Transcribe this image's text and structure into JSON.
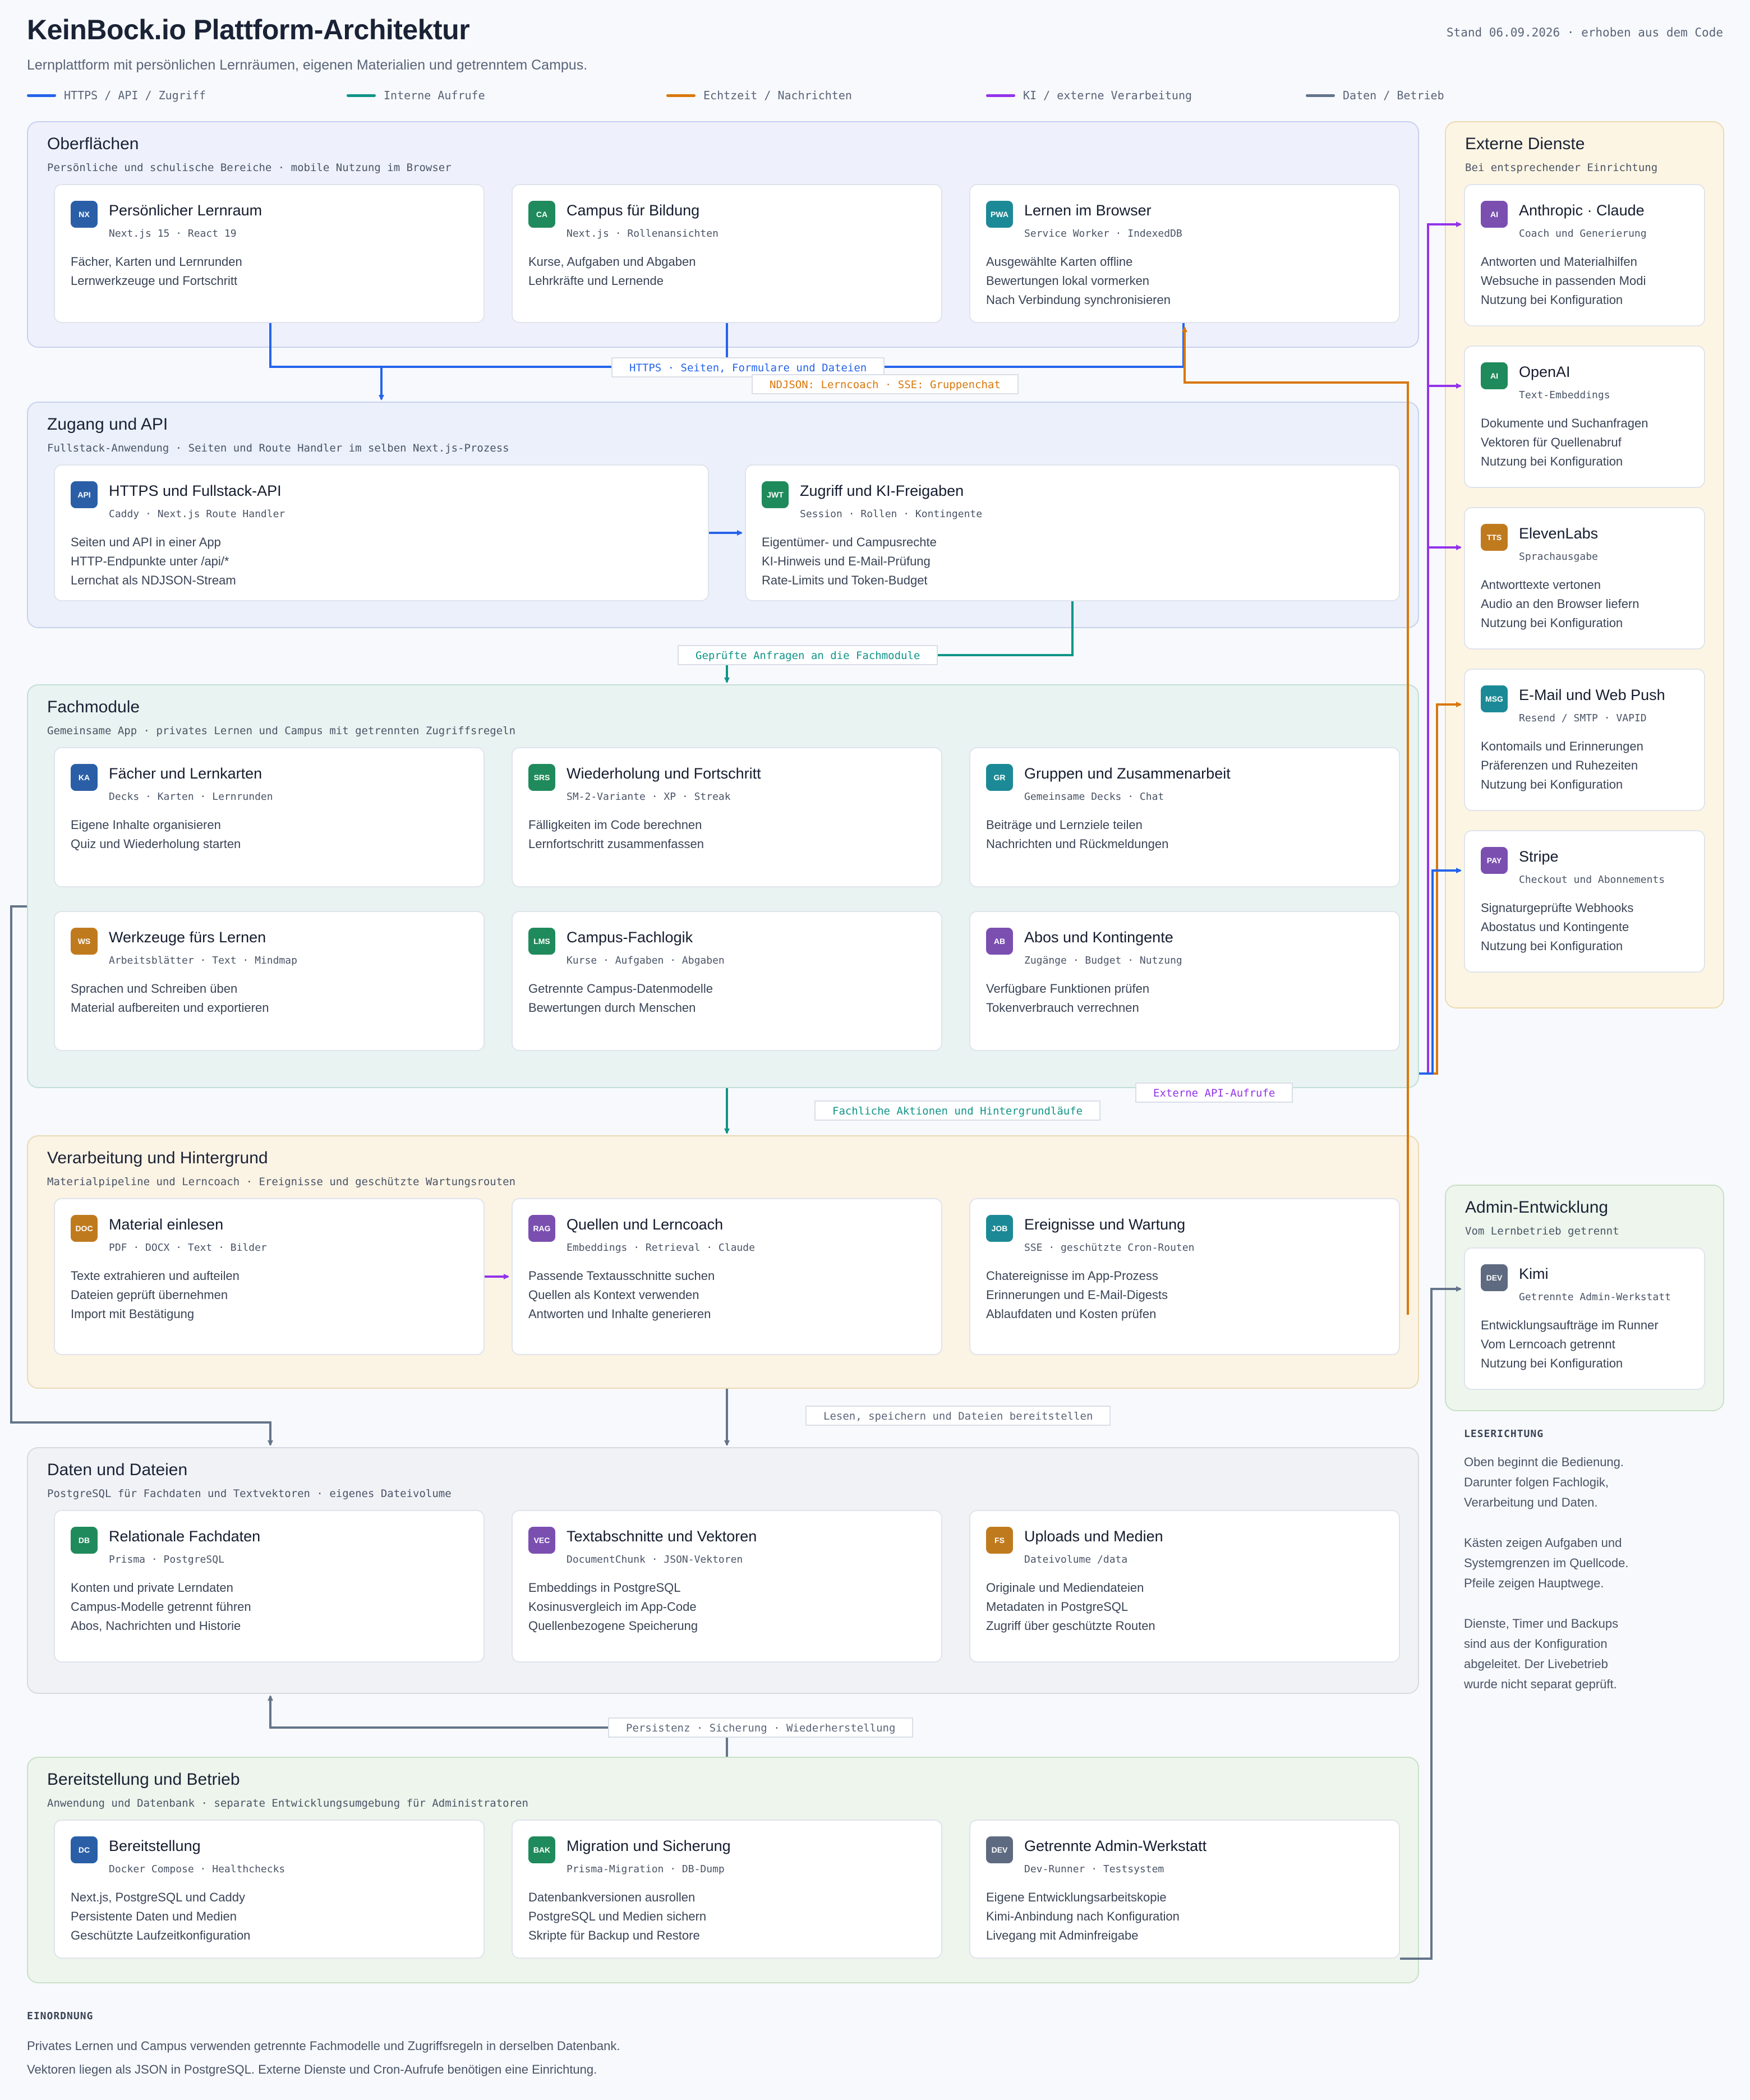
{
  "header": {
    "title": "KeinBock.io Plattform-Architektur",
    "subtitle": "Lernplattform mit persönlichen Lernräumen, eigenen Materialien und getrenntem Campus.",
    "stand": "Stand 06.09.2026 · erhoben aus dem Code"
  },
  "legend": [
    {
      "label": "HTTPS / API / Zugriff",
      "color": "#2563eb"
    },
    {
      "label": "Interne Aufrufe",
      "color": "#0f9488"
    },
    {
      "label": "Echtzeit / Nachrichten",
      "color": "#d9770b"
    },
    {
      "label": "KI / externe Verarbeitung",
      "color": "#9333ea"
    },
    {
      "label": "Daten / Betrieb",
      "color": "#64748b"
    }
  ],
  "zones": {
    "surfaces": {
      "title": "Oberflächen",
      "sub": "Persönliche und schulische Bereiche · mobile Nutzung im Browser"
    },
    "access": {
      "title": "Zugang und API",
      "sub": "Fullstack-Anwendung · Seiten und Route Handler im selben Next.js-Prozess"
    },
    "domain": {
      "title": "Fachmodule",
      "sub": "Gemeinsame App · privates Lernen und Campus mit getrennten Zugriffsregeln"
    },
    "processing": {
      "title": "Verarbeitung und Hintergrund",
      "sub": "Materialpipeline und Lerncoach · Ereignisse und geschützte Wartungsrouten"
    },
    "data": {
      "title": "Daten und Dateien",
      "sub": "PostgreSQL für Fachdaten und Textvektoren · eigenes Dateivolume"
    },
    "ops": {
      "title": "Bereitstellung und Betrieb",
      "sub": "Anwendung und Datenbank · separate Entwicklungsumgebung für Administratoren"
    },
    "external": {
      "title": "Externe Dienste",
      "sub": "Bei entsprechender Einrichtung"
    },
    "admin": {
      "title": "Admin-Entwicklung",
      "sub": "Vom Lernbetrieb getrennt"
    }
  },
  "cards": {
    "nx": {
      "badge": "NX",
      "title": "Persönlicher Lernraum",
      "sub": "Next.js 15 · React 19",
      "lines": [
        "Fächer, Karten und Lernrunden",
        "Lernwerkzeuge und Fortschritt"
      ]
    },
    "ca": {
      "badge": "CA",
      "title": "Campus für Bildung",
      "sub": "Next.js · Rollenansichten",
      "lines": [
        "Kurse, Aufgaben und Abgaben",
        "Lehrkräfte und Lernende"
      ]
    },
    "pwa": {
      "badge": "PWA",
      "title": "Lernen im Browser",
      "sub": "Service Worker · IndexedDB",
      "lines": [
        "Ausgewählte Karten offline",
        "Bewertungen lokal vormerken",
        "Nach Verbindung synchronisieren"
      ]
    },
    "api": {
      "badge": "API",
      "title": "HTTPS und Fullstack-API",
      "sub": "Caddy · Next.js Route Handler",
      "lines": [
        "Seiten und API in einer App",
        "HTTP-Endpunkte unter /api/*",
        "Lernchat als NDJSON-Stream"
      ]
    },
    "jwt": {
      "badge": "JWT",
      "title": "Zugriff und KI-Freigaben",
      "sub": "Session · Rollen · Kontingente",
      "lines": [
        "Eigentümer- und Campusrechte",
        "KI-Hinweis und E-Mail-Prüfung",
        "Rate-Limits und Token-Budget"
      ]
    },
    "ka": {
      "badge": "KA",
      "title": "Fächer und Lernkarten",
      "sub": "Decks · Karten · Lernrunden",
      "lines": [
        "Eigene Inhalte organisieren",
        "Quiz und Wiederholung starten"
      ]
    },
    "srs": {
      "badge": "SRS",
      "title": "Wiederholung und Fortschritt",
      "sub": "SM-2-Variante · XP · Streak",
      "lines": [
        "Fälligkeiten im Code berechnen",
        "Lernfortschritt zusammenfassen"
      ]
    },
    "gr": {
      "badge": "GR",
      "title": "Gruppen und Zusammenarbeit",
      "sub": "Gemeinsame Decks · Chat",
      "lines": [
        "Beiträge und Lernziele teilen",
        "Nachrichten und Rückmeldungen"
      ]
    },
    "ws": {
      "badge": "WS",
      "title": "Werkzeuge fürs Lernen",
      "sub": "Arbeitsblätter · Text · Mindmap",
      "lines": [
        "Sprachen und Schreiben üben",
        "Material aufbereiten und exportieren"
      ]
    },
    "lms": {
      "badge": "LMS",
      "title": "Campus-Fachlogik",
      "sub": "Kurse · Aufgaben · Abgaben",
      "lines": [
        "Getrennte Campus-Datenmodelle",
        "Bewertungen durch Menschen"
      ]
    },
    "ab": {
      "badge": "AB",
      "title": "Abos und Kontingente",
      "sub": "Zugänge · Budget · Nutzung",
      "lines": [
        "Verfügbare Funktionen prüfen",
        "Tokenverbrauch verrechnen"
      ]
    },
    "doc": {
      "badge": "DOC",
      "title": "Material einlesen",
      "sub": "PDF · DOCX · Text · Bilder",
      "lines": [
        "Texte extrahieren und aufteilen",
        "Dateien geprüft übernehmen",
        "Import mit Bestätigung"
      ]
    },
    "rag": {
      "badge": "RAG",
      "title": "Quellen und Lerncoach",
      "sub": "Embeddings · Retrieval · Claude",
      "lines": [
        "Passende Textausschnitte suchen",
        "Quellen als Kontext verwenden",
        "Antworten und Inhalte generieren"
      ]
    },
    "job": {
      "badge": "JOB",
      "title": "Ereignisse und Wartung",
      "sub": "SSE · geschützte Cron-Routen",
      "lines": [
        "Chatereignisse im App-Prozess",
        "Erinnerungen und E-Mail-Digests",
        "Ablaufdaten und Kosten prüfen"
      ]
    },
    "db": {
      "badge": "DB",
      "title": "Relationale Fachdaten",
      "sub": "Prisma · PostgreSQL",
      "lines": [
        "Konten und private Lerndaten",
        "Campus-Modelle getrennt führen",
        "Abos, Nachrichten und Historie"
      ]
    },
    "vec": {
      "badge": "VEC",
      "title": "Textabschnitte und Vektoren",
      "sub": "DocumentChunk · JSON-Vektoren",
      "lines": [
        "Embeddings in PostgreSQL",
        "Kosinusvergleich im App-Code",
        "Quellenbezogene Speicherung"
      ]
    },
    "fs": {
      "badge": "FS",
      "title": "Uploads und Medien",
      "sub": "Dateivolume /data",
      "lines": [
        "Originale und Mediendateien",
        "Metadaten in PostgreSQL",
        "Zugriff über geschützte Routen"
      ]
    },
    "dc": {
      "badge": "DC",
      "title": "Bereitstellung",
      "sub": "Docker Compose · Healthchecks",
      "lines": [
        "Next.js, PostgreSQL und Caddy",
        "Persistente Daten und Medien",
        "Geschützte Laufzeitkonfiguration"
      ]
    },
    "bak": {
      "badge": "BAK",
      "title": "Migration und Sicherung",
      "sub": "Prisma-Migration · DB-Dump",
      "lines": [
        "Datenbankversionen ausrollen",
        "PostgreSQL und Medien sichern",
        "Skripte für Backup und Restore"
      ]
    },
    "dev": {
      "badge": "DEV",
      "title": "Getrennte Admin-Werkstatt",
      "sub": "Dev-Runner · Testsystem",
      "lines": [
        "Eigene Entwicklungsarbeitskopie",
        "Kimi-Anbindung nach Konfiguration",
        "Livegang mit Adminfreigabe"
      ]
    },
    "anthropic": {
      "badge": "AI",
      "title": "Anthropic · Claude",
      "sub": "Coach und Generierung",
      "lines": [
        "Antworten und Materialhilfen",
        "Websuche in passenden Modi",
        "Nutzung bei Konfiguration"
      ]
    },
    "openai": {
      "badge": "AI",
      "title": "OpenAI",
      "sub": "Text-Embeddings",
      "lines": [
        "Dokumente und Suchanfragen",
        "Vektoren für Quellenabruf",
        "Nutzung bei Konfiguration"
      ]
    },
    "eleven": {
      "badge": "TTS",
      "title": "ElevenLabs",
      "sub": "Sprachausgabe",
      "lines": [
        "Antworttexte vertonen",
        "Audio an den Browser liefern",
        "Nutzung bei Konfiguration"
      ]
    },
    "mail": {
      "badge": "MSG",
      "title": "E-Mail und Web Push",
      "sub": "Resend / SMTP · VAPID",
      "lines": [
        "Kontomails und Erinnerungen",
        "Präferenzen und Ruhezeiten",
        "Nutzung bei Konfiguration"
      ]
    },
    "stripe": {
      "badge": "PAY",
      "title": "Stripe",
      "sub": "Checkout und Abonnements",
      "lines": [
        "Signaturgeprüfte Webhooks",
        "Abostatus und Kontingente",
        "Nutzung bei Konfiguration"
      ]
    },
    "kimi": {
      "badge": "DEV",
      "title": "Kimi",
      "sub": "Getrennte Admin-Werkstatt",
      "lines": [
        "Entwicklungsaufträge im Runner",
        "Vom Lerncoach getrennt",
        "Nutzung bei Konfiguration"
      ]
    }
  },
  "labels": {
    "https": "HTTPS · Seiten, Formulare und Dateien",
    "ndjson": "NDJSON: Lerncoach · SSE: Gruppenchat",
    "checked": "Geprüfte Anfragen an die Fachmodule",
    "actions": "Fachliche Aktionen und Hintergrundläufe",
    "external": "Externe API-Aufrufe",
    "readwrite": "Lesen, speichern und Dateien bereitstellen",
    "persist": "Persistenz · Sicherung · Wiederherstellung"
  },
  "reading": {
    "head": "LESERICHTUNG",
    "lines": [
      "Oben beginnt die Bedienung.",
      "Darunter folgen Fachlogik,",
      "Verarbeitung und Daten.",
      "",
      "Kästen zeigen Aufgaben und",
      "Systemgrenzen im Quellcode.",
      "Pfeile zeigen Hauptwege.",
      "",
      "Dienste, Timer und Backups",
      "sind aus der Konfiguration",
      "abgeleitet. Der Livebetrieb",
      "wurde nicht separat geprüft."
    ]
  },
  "footer": {
    "head": "EINORDNUNG",
    "lines": [
      "Privates Lernen und Campus verwenden getrennte Fachmodelle und Zugriffsregeln in derselben Datenbank.",
      "Vektoren liegen als JSON in PostgreSQL. Externe Dienste und Cron-Aufrufe benötigen eine Einrichtung."
    ]
  }
}
